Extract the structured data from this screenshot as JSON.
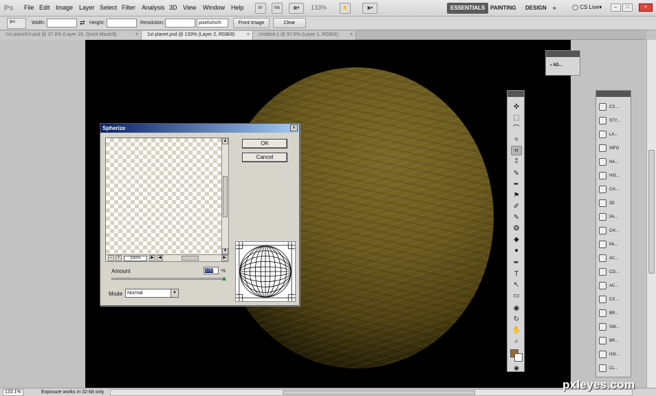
{
  "app": {
    "logo_text": "Ps"
  },
  "menu": [
    "File",
    "Edit",
    "Image",
    "Layer",
    "Select",
    "Filter",
    "Analysis",
    "3D",
    "View",
    "Window",
    "Help"
  ],
  "menubar_buttons": {
    "br": "Br",
    "mb": "Mb"
  },
  "zoom_level": "133%",
  "workspaces": {
    "essentials": "ESSENTIALS",
    "painting": "PAINTING",
    "design": "DESIGN",
    "more": "»"
  },
  "cs_live": "CS Live",
  "window_controls": {
    "minimize": "–",
    "restore": "□",
    "close": "×"
  },
  "options": {
    "width_label": "Width:",
    "swap": "⇄",
    "height_label": "Height:",
    "resolution_label": "Resolution:",
    "resolution_unit": "pixels/inch",
    "front_image": "Front Image",
    "clear": "Clear"
  },
  "tabs": [
    {
      "label": "1st planetUI.psd @ 37.6% (Layer 10, Quick Mask/8)",
      "close": "×"
    },
    {
      "label": "1st planet.psd @ 133% (Layer 2, RGB/8)",
      "close": "×"
    },
    {
      "label": "Untitled-1 @ 97.6% (Layer 1, RGB/8)",
      "close": "×"
    }
  ],
  "mini_panel": {
    "label": "AD..."
  },
  "dock_items": [
    "CS ...",
    "STY...",
    "LA...",
    "INFO",
    "NA...",
    "HIS...",
    "CH...",
    "3D",
    "PA...",
    "CH...",
    "PA...",
    "AC...",
    "CO...",
    "AC...",
    "CS ...",
    "BR...",
    "SW...",
    "BR...",
    "HIS...",
    "CL..."
  ],
  "tools_icons": [
    "✜",
    "⬚",
    "⌒",
    "✧",
    "⌗",
    "‡",
    "✎",
    "✒",
    "⚑",
    "✐",
    "✎",
    "❂",
    "◆",
    "●",
    "✒",
    "T",
    "↖",
    "▭",
    "◉",
    "↻",
    "✋",
    "⌕"
  ],
  "dialog": {
    "title": "Spherize",
    "close": "×",
    "zoom": "100%",
    "zoom_out": "–",
    "zoom_in": "+",
    "ok": "OK",
    "cancel": "Cancel",
    "amount_label": "Amount",
    "amount_value": "100",
    "amount_unit": "%",
    "mode_label": "Mode",
    "mode_value": "Normal"
  },
  "status": {
    "zoom": "133.1%",
    "message": "Exposure works in 32-bit only"
  },
  "watermark": "pxleyes.com",
  "colors": {
    "foreground": "#9a6a32",
    "background": "#ffffff",
    "title_bar": "#0a246a"
  }
}
